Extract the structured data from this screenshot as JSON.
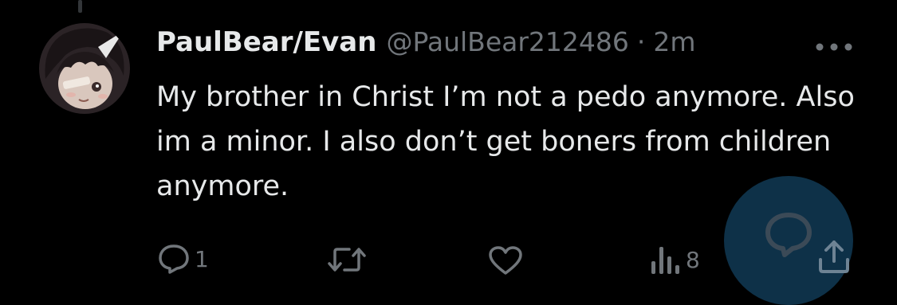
{
  "post": {
    "display_name": "PaulBear/Evan",
    "handle": "@PaulBear212486",
    "separator": "·",
    "time": "2m",
    "text": "My brother in Christ I’m not a pedo anymore. Also im a minor. I also don’t get boners from children anymore."
  },
  "actions": {
    "reply_count": "1",
    "repost_count": "",
    "like_count": "",
    "views_count": "8"
  },
  "icons": {
    "avatar": "avatar",
    "more": "more-icon",
    "reply": "reply-icon",
    "repost": "repost-icon",
    "like": "heart-icon",
    "views": "views-icon",
    "share": "share-icon",
    "compose": "reply-compose-icon"
  },
  "colors": {
    "background": "#000000",
    "primary_text": "#e7e9ea",
    "secondary_text": "#71767b",
    "fab": "#0e3148",
    "fab_icon": "#3b4a57"
  }
}
